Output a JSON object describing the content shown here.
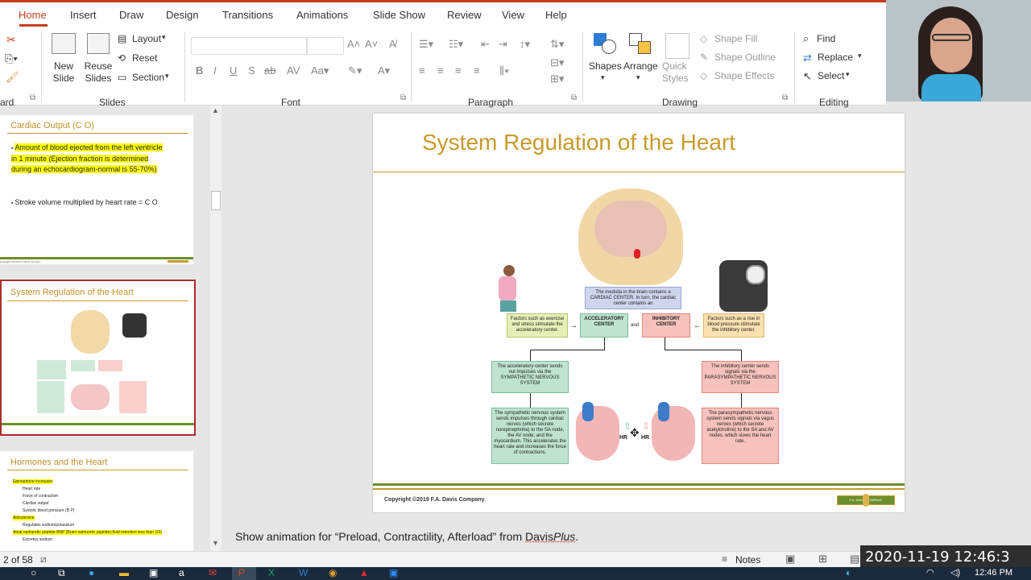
{
  "tabs": [
    "Home",
    "Insert",
    "Draw",
    "Design",
    "Transitions",
    "Animations",
    "Slide Show",
    "Review",
    "View",
    "Help"
  ],
  "ribbon": {
    "clipboard_label": "ard",
    "slides": {
      "new_slide": "New Slide",
      "reuse_slides": "Reuse Slides",
      "layout": "Layout",
      "reset": "Reset",
      "section": "Section",
      "label": "Slides"
    },
    "font_label": "Font",
    "paragraph_label": "Paragraph",
    "drawing": {
      "shapes": "Shapes",
      "arrange": "Arrange",
      "quick_styles": "Quick Styles",
      "shape_fill": "Shape Fill",
      "shape_outline": "Shape Outline",
      "shape_effects": "Shape Effects",
      "label": "Drawing"
    },
    "editing": {
      "find": "Find",
      "replace": "Replace",
      "select": "Select",
      "label": "Editing"
    }
  },
  "thumbnails": [
    {
      "title": "Cardiac Output (C O)",
      "bullet1": "Amount of blood ejected from the left ventricle in 1 minute (Ejection fraction is determined during an echocardiogram-normal is 55-70%)",
      "bullet2": "Stroke volume multiplied by heart rate = C O",
      "footer": "Copyright ©2019 F.A. Davis Company"
    },
    {
      "title": "System Regulation of the Heart"
    },
    {
      "title": "Hormones and the Heart",
      "items": [
        "Epinephrine increases",
        "Heart rate",
        "Force of contraction",
        "Cardiac output",
        "Systolic blood pressure (B P)",
        "Aldosterone",
        "Regulates sodium/potassium",
        "Atrial natriuretic peptide-BNP (Brain natriuretic peptide)-fluid retention less than 100",
        "Excretes sodium"
      ]
    }
  ],
  "slide": {
    "title": "System Regulation of the Heart",
    "copyright": "Copyright ©2019 F.A. Davis Company",
    "logo": "F.A. DAVIS COMPANY",
    "diagram": {
      "medulla": "The medulla in the brain contains a CARDIAC CENTER. In turn, the cardiac center contains an",
      "left_factors": "Factors such as exercise and stress stimulate the acceleratory center.",
      "accel": "ACCELERATORY CENTER",
      "and": "and",
      "inhib": "INHIBITORY CENTER",
      "right_factors": "Factors such as a rise in blood pressure stimulate the inhibitory center.",
      "sympathetic": "The acceleratory center sends out impulses via the SYMPATHETIC NERVOUS SYSTEM",
      "parasympathetic": "The inhibitory center sends signals via the PARASYMPATHETIC NERVOUS SYSTEM",
      "sym_detail": "The sympathetic nervous system sends impulses through cardiac nerves (which secrete norepinephrine) to the SA node, the AV node, and the myocardium. This accelerates the heart rate and increases the force of contractions.",
      "para_detail": "The parasympathetic nervous system sends signals via vagus nerves (which secrete acetylcholine) to the SA and AV nodes, which slows the heart rate.",
      "hr1": "HR",
      "hr2": "HR"
    }
  },
  "notes": {
    "prefix": "Show animation for “Preload, Contractility, Afterload” from ",
    "link_a": "Davis",
    "link_b": "Plus",
    "suffix": "."
  },
  "status": {
    "slide_count": "e 2 of 58",
    "notes_button": "Notes",
    "timestamp": "2020-11-19 12:46:3"
  },
  "taskbar": {
    "clock": "12:46 PM"
  },
  "colors": {
    "accent": "#c43e1c",
    "title_gold": "#c89a2c",
    "highlight": "#ffff00"
  }
}
